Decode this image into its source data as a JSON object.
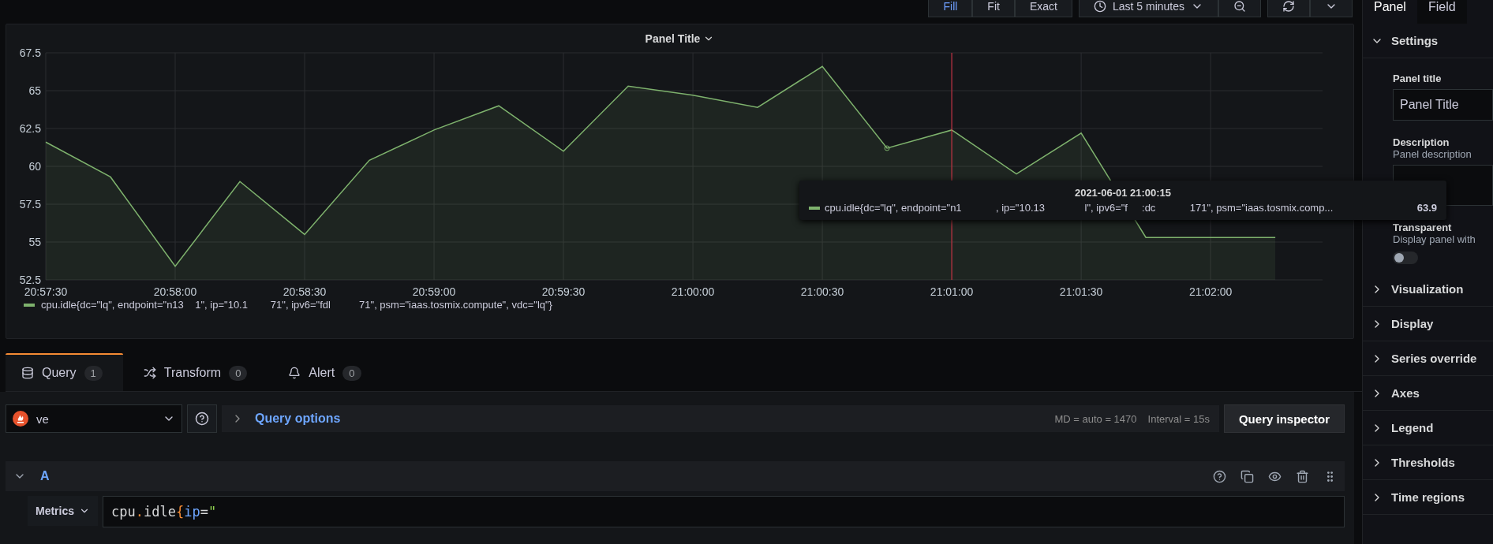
{
  "toolbar": {
    "view_modes": [
      {
        "label": "Fill",
        "selected": true
      },
      {
        "label": "Fit",
        "selected": false
      },
      {
        "label": "Exact",
        "selected": false
      }
    ],
    "time_range": "Last 5 minutes"
  },
  "panel": {
    "title": "Panel Title",
    "chart_data": {
      "type": "area",
      "ylim": [
        52.5,
        67.5
      ],
      "categories": [
        "20:57:30",
        null,
        "20:58:00",
        null,
        "20:58:30",
        null,
        "20:59:00",
        null,
        "20:59:30",
        null,
        "21:00:00",
        null,
        "21:00:30",
        null,
        "21:01:00",
        null,
        "21:01:30",
        null,
        "21:02:00",
        null
      ],
      "series": [
        {
          "name": "cpu.idle{dc=\"lq\", endpoint=\"n13    1\", ip=\"10.1        71\", ipv6=\"fdl          71\", psm=\"iaas.tosmix.compute\", vdc=\"lq\"}",
          "color": "#7eb26d",
          "values": [
            61.6,
            59.3,
            53.4,
            59.0,
            55.5,
            60.4,
            62.4,
            64.0,
            61.0,
            65.3,
            64.7,
            63.9,
            66.6,
            61.2,
            62.4,
            59.5,
            62.2,
            55.3,
            55.3,
            55.3
          ]
        }
      ],
      "yticks": [
        {
          "value": 52.5,
          "label": "52.5"
        },
        {
          "value": 55,
          "label": "55"
        },
        {
          "value": 57.5,
          "label": "57.5"
        },
        {
          "value": 60,
          "label": "60"
        },
        {
          "value": 62.5,
          "label": "62.5"
        },
        {
          "value": 65,
          "label": "65"
        },
        {
          "value": 67.5,
          "label": "67.5"
        }
      ],
      "grid": true
    },
    "tooltip": {
      "time": "2021-06-01 21:00:15",
      "series": [
        {
          "label": "cpu.idle{dc=\"lq\", endpoint=\"n1            , ip=\"10.13              l\", ipv6=\"f     :dc            171\", psm=\"iaas.tosmix.comp...",
          "value": "63.9",
          "color": "#7eb26d"
        }
      ]
    }
  },
  "query_tabs": [
    {
      "label": "Query",
      "count": "1",
      "selected": true
    },
    {
      "label": "Transform",
      "count": "0",
      "selected": false
    },
    {
      "label": "Alert",
      "count": "0",
      "selected": false
    }
  ],
  "datasource": "ve",
  "query_options": {
    "label": "Query options",
    "expanded": false,
    "max_data_points": "MD = auto = 1470",
    "interval": "Interval = 15s"
  },
  "query_inspector": "Query inspector",
  "query": {
    "ref": "A",
    "expanded": true,
    "type": "Metrics",
    "tokens": [
      {
        "text": "cpu",
        "kind": "ident"
      },
      {
        "text": ".",
        "kind": "punct"
      },
      {
        "text": "idle",
        "kind": "ident"
      },
      {
        "text": "{",
        "kind": "punct"
      },
      {
        "text": "ip",
        "kind": "label"
      },
      {
        "text": "=",
        "kind": "op"
      },
      {
        "text": "\"",
        "kind": "string"
      }
    ]
  },
  "sidebar": {
    "tabs": [
      {
        "label": "Panel",
        "selected": true
      },
      {
        "label": "Field",
        "selected": false
      }
    ],
    "settings": {
      "title": "Settings",
      "expanded": true,
      "panel_title_label": "Panel title",
      "panel_title_value": "Panel Title",
      "description_label": "Description",
      "description_hint": "Panel description",
      "transparent_label": "Transparent",
      "transparent_hint": "Display panel with",
      "transparent_on": false
    },
    "sections": [
      {
        "title": "Visualization",
        "expanded": false
      },
      {
        "title": "Display",
        "expanded": false
      },
      {
        "title": "Series override",
        "expanded": false
      },
      {
        "title": "Axes",
        "expanded": false
      },
      {
        "title": "Legend",
        "expanded": false
      },
      {
        "title": "Thresholds",
        "expanded": false
      },
      {
        "title": "Time regions",
        "expanded": false
      }
    ]
  }
}
